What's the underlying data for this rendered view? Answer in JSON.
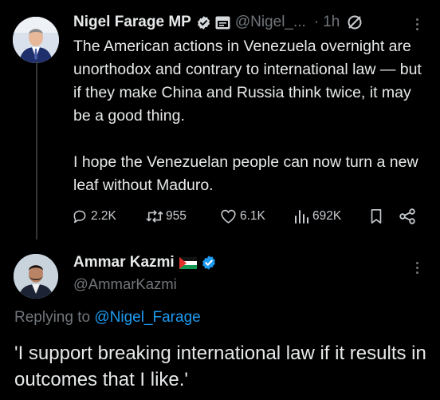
{
  "tweet": {
    "author_name": "Nigel Farage MP",
    "handle": "@Nigel_...",
    "separator": "·",
    "time": "1h",
    "paragraphs": [
      "The American actions in Venezuela overnight are unorthodox and contrary to international law — but if they make China and Russia think twice, it may be a good thing.",
      "I hope the Venezuelan people can now turn a new leaf without Maduro."
    ],
    "stats": {
      "replies": "2.2K",
      "reposts": "955",
      "likes": "6.1K",
      "views": "692K"
    },
    "icons": [
      "verified-badge-icon",
      "affiliate-badge-icon",
      "grok-slash-icon",
      "more-icon",
      "reply-icon",
      "repost-icon",
      "like-icon",
      "views-icon",
      "bookmark-icon",
      "share-icon"
    ],
    "colors": {
      "verified": "#1d9bf0",
      "muted": "#71767b"
    }
  },
  "reply": {
    "author_name": "Ammar Kazmi",
    "flag": "palestine-flag-icon",
    "handle": "@AmmarKazmi",
    "replying_prefix": "Replying to",
    "replying_to": "@Nigel_Farage",
    "text": "'I support breaking international law if it results in outcomes that I like.'"
  }
}
